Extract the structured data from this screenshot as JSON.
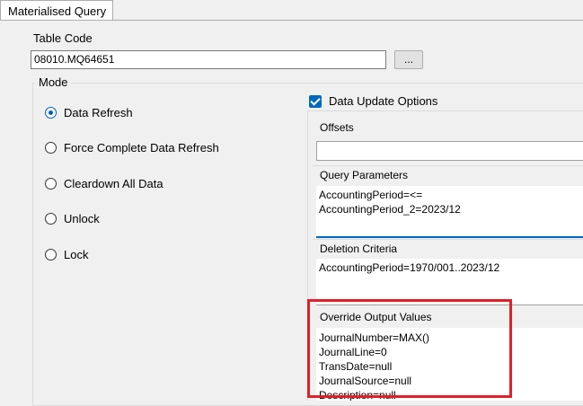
{
  "tab": {
    "label": "Materialised Query"
  },
  "table_code": {
    "label": "Table Code",
    "value": "08010.MQ64651",
    "browse_label": "..."
  },
  "mode": {
    "title": "Mode",
    "options": [
      {
        "label": "Data Refresh",
        "checked": true
      },
      {
        "label": "Force Complete Data Refresh",
        "checked": false
      },
      {
        "label": "Cleardown All Data",
        "checked": false
      },
      {
        "label": "Unlock",
        "checked": false
      },
      {
        "label": "Lock",
        "checked": false
      }
    ]
  },
  "data_update": {
    "checkbox_label": "Data Update Options",
    "checked": true,
    "offsets": {
      "label": "Offsets",
      "value": ""
    },
    "query_parameters": {
      "label": "Query Parameters",
      "lines": [
        "AccountingPeriod=<=",
        "AccountingPeriod_2=2023/12"
      ]
    },
    "deletion_criteria": {
      "label": "Deletion Criteria",
      "lines": [
        "AccountingPeriod=1970/001..2023/12"
      ]
    },
    "override_output": {
      "label": "Override Output Values",
      "lines": [
        "JournalNumber=MAX()",
        "JournalLine=0",
        "TransDate=null",
        "JournalSource=null",
        "Description=null"
      ]
    }
  },
  "colors": {
    "highlight": "#e0202a",
    "accent": "#0067c0"
  }
}
